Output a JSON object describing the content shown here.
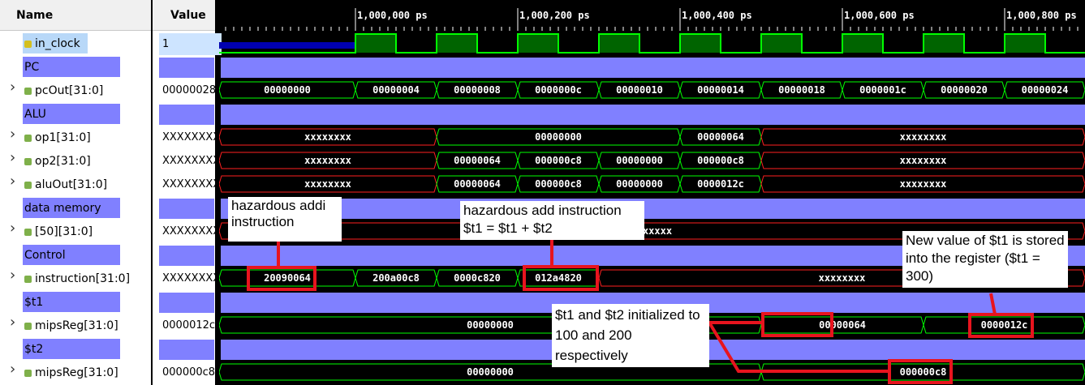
{
  "headers": {
    "name": "Name",
    "value": "Value"
  },
  "time_ruler": [
    "1,000,000 ps",
    "1,000,200 ps",
    "1,000,400 ps",
    "1,000,600 ps",
    "1,000,800 ps"
  ],
  "colors": {
    "divider": "#8080ff",
    "wave": "#00ff00",
    "unknown": "#ff2020",
    "clock_fill": "#006400",
    "highlight": "#e8141e"
  },
  "rows": [
    {
      "kind": "signal",
      "name": "in_clock",
      "value": "1",
      "icon": "clock-icon",
      "expandable": false,
      "selected": true
    },
    {
      "kind": "divider",
      "name": "PC",
      "value": ""
    },
    {
      "kind": "signal",
      "name": "pcOut[31:0]",
      "value": "00000028",
      "icon": "bus-icon",
      "expandable": true
    },
    {
      "kind": "divider",
      "name": "ALU",
      "value": ""
    },
    {
      "kind": "signal",
      "name": "op1[31:0]",
      "value": "XXXXXXXX",
      "icon": "bus-icon",
      "expandable": true
    },
    {
      "kind": "signal",
      "name": "op2[31:0]",
      "value": "XXXXXXXX",
      "icon": "bus-icon",
      "expandable": true
    },
    {
      "kind": "signal",
      "name": "aluOut[31:0]",
      "value": "XXXXXXXX",
      "icon": "bus-icon",
      "expandable": true
    },
    {
      "kind": "divider",
      "name": "data memory",
      "value": ""
    },
    {
      "kind": "signal",
      "name": "[50][31:0]",
      "value": "XXXXXXXX",
      "icon": "bus-icon",
      "expandable": true
    },
    {
      "kind": "divider",
      "name": "Control",
      "value": ""
    },
    {
      "kind": "signal",
      "name": "instruction[31:0]",
      "value": "XXXXXXXX",
      "icon": "bus-icon",
      "expandable": true
    },
    {
      "kind": "divider",
      "name": "$t1",
      "value": ""
    },
    {
      "kind": "signal",
      "name": "mipsReg[31:0]",
      "value": "0000012c",
      "icon": "bus-icon",
      "expandable": true
    },
    {
      "kind": "divider",
      "name": "$t2",
      "value": ""
    },
    {
      "kind": "signal",
      "name": "mipsReg[31:0]",
      "value": "000000c8",
      "icon": "bus-icon",
      "expandable": true
    }
  ],
  "waves": {
    "pcOut": [
      "00000000",
      "00000004",
      "00000008",
      "0000000c",
      "00000010",
      "00000014",
      "00000018",
      "0000001c",
      "00000020",
      "00000024"
    ],
    "op1": [
      "xxxxxxxx",
      "00000000",
      "00000064",
      "xxxxxxxx"
    ],
    "op2": [
      "xxxxxxxx",
      "00000064",
      "000000c8",
      "00000000",
      "000000c8",
      "xxxxxxxx"
    ],
    "aluOut": [
      "xxxxxxxx",
      "00000064",
      "000000c8",
      "00000000",
      "0000012c",
      "xxxxxxxx"
    ],
    "mem50": [
      "xxxxx"
    ],
    "instruction": [
      "20090064",
      "200a00c8",
      "0000c820",
      "012a4820",
      "xxxxxxxx"
    ],
    "t1": [
      "00000000",
      "00000064",
      "0000012c"
    ],
    "t2": [
      "00000000",
      "000000c8"
    ]
  },
  "annotations": {
    "addi": "hazardous addi instruction",
    "add_line1": "hazardous add instruction",
    "add_line2": "$t1 = $t1 + $t2",
    "newval": "New value of $t1 is stored into the register ($t1 = 300)",
    "init": "$t1 and $t2 initialized to 100 and 200 respectively"
  }
}
